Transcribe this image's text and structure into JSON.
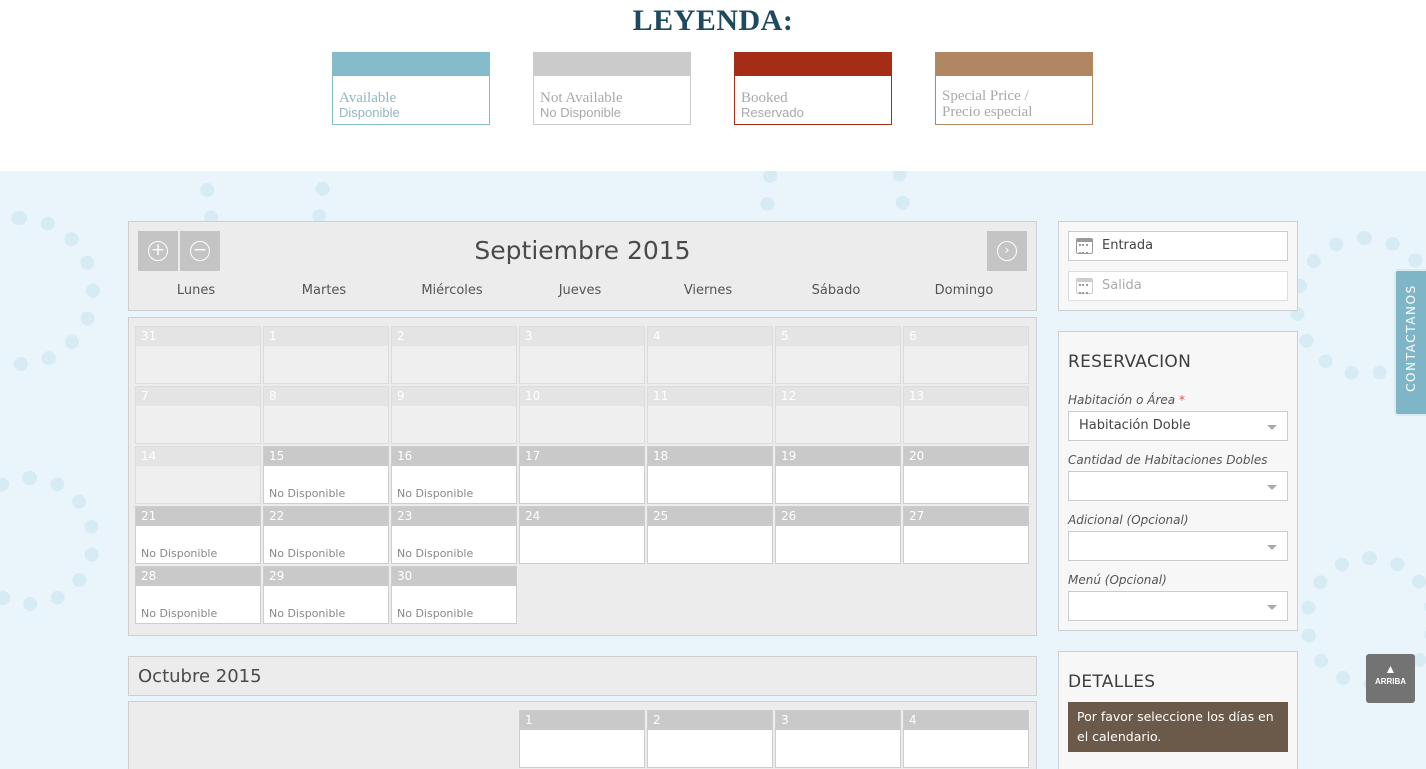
{
  "legend": {
    "title": "LEYENDA:",
    "items": [
      {
        "en": "Available",
        "es": "Disponible",
        "color": "#85bccc"
      },
      {
        "en": "Not Available",
        "es": "No Disponible",
        "color": "#cbcbcb"
      },
      {
        "en": "Booked",
        "es": "Reservado",
        "color": "#a52c16"
      },
      {
        "en": "Special Price /",
        "es": "Precio especial",
        "color": "#b08762"
      }
    ]
  },
  "calendar": {
    "month_title": "Septiembre 2015",
    "prev_icon": "plus-circle-icon",
    "zoom_icon": "minus-circle-icon",
    "next_icon": "chevron-right-circle-icon",
    "weekdays": [
      "Lunes",
      "Martes",
      "Miércoles",
      "Jueves",
      "Viernes",
      "Sábado",
      "Domingo"
    ],
    "weeks": [
      [
        {
          "d": "31",
          "s": "",
          "past": true
        },
        {
          "d": "1",
          "s": "",
          "past": true
        },
        {
          "d": "2",
          "s": "",
          "past": true
        },
        {
          "d": "3",
          "s": "",
          "past": true
        },
        {
          "d": "4",
          "s": "",
          "past": true
        },
        {
          "d": "5",
          "s": "",
          "past": true
        },
        {
          "d": "6",
          "s": "",
          "past": true
        }
      ],
      [
        {
          "d": "7",
          "s": "",
          "past": true
        },
        {
          "d": "8",
          "s": "",
          "past": true
        },
        {
          "d": "9",
          "s": "",
          "past": true
        },
        {
          "d": "10",
          "s": "",
          "past": true
        },
        {
          "d": "11",
          "s": "",
          "past": true
        },
        {
          "d": "12",
          "s": "",
          "past": true
        },
        {
          "d": "13",
          "s": "",
          "past": true
        }
      ],
      [
        {
          "d": "14",
          "s": "",
          "past": true
        },
        {
          "d": "15",
          "s": "No Disponible"
        },
        {
          "d": "16",
          "s": "No Disponible"
        },
        {
          "d": "17",
          "s": ""
        },
        {
          "d": "18",
          "s": ""
        },
        {
          "d": "19",
          "s": ""
        },
        {
          "d": "20",
          "s": ""
        }
      ],
      [
        {
          "d": "21",
          "s": "No Disponible"
        },
        {
          "d": "22",
          "s": "No Disponible"
        },
        {
          "d": "23",
          "s": "No Disponible"
        },
        {
          "d": "24",
          "s": ""
        },
        {
          "d": "25",
          "s": ""
        },
        {
          "d": "26",
          "s": ""
        },
        {
          "d": "27",
          "s": ""
        }
      ],
      [
        {
          "d": "28",
          "s": "No Disponible"
        },
        {
          "d": "29",
          "s": "No Disponible"
        },
        {
          "d": "30",
          "s": "No Disponible"
        }
      ]
    ],
    "next_month_title": "Octubre 2015",
    "next_month_first_week": [
      "1",
      "2",
      "3",
      "4"
    ]
  },
  "dates": {
    "checkin_placeholder": "Entrada",
    "checkout_placeholder": "Salida"
  },
  "reservation": {
    "title": "RESERVACION",
    "room_label": "Habitación o Área",
    "required_mark": "*",
    "room_value": "Habitación Doble",
    "qty_label": "Cantidad de Habitaciones Dobles",
    "qty_value": "",
    "extra_label": "Adicional (Opcional)",
    "extra_value": "",
    "menu_label": "Menú (Opcional)",
    "menu_value": ""
  },
  "details": {
    "title": "DETALLES",
    "notice": "Por favor seleccione los días en el calendario."
  },
  "side_tab": "CONTACTANOS",
  "back_to_top": "ARRIBA"
}
